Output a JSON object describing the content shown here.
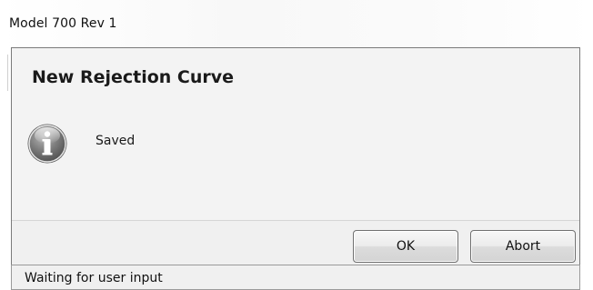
{
  "window": {
    "title": "Model 700 Rev 1"
  },
  "dialog": {
    "heading": "New Rejection Curve",
    "message": "Saved",
    "icon": "info-icon",
    "buttons": {
      "ok_label": "OK",
      "abort_label": "Abort"
    }
  },
  "status_bar": {
    "text": "Waiting for user input"
  },
  "colors": {
    "dialog_background": "#f0f0f0",
    "border": "#7a7a7a",
    "icon_gray": "#6f6f6f"
  }
}
